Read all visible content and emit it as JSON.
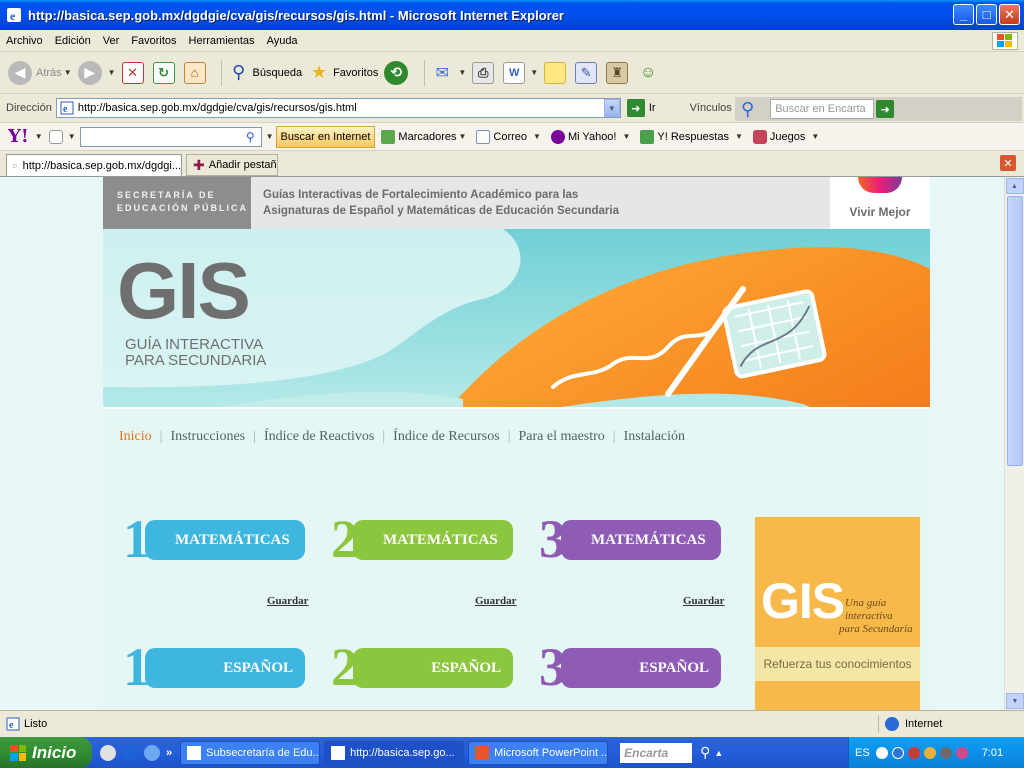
{
  "window": {
    "title": "http://basica.sep.gob.mx/dgdgie/cva/gis/recursos/gis.html - Microsoft Internet Explorer"
  },
  "menu": [
    "Archivo",
    "Edición",
    "Ver",
    "Favoritos",
    "Herramientas",
    "Ayuda"
  ],
  "toolbar": {
    "back": "Atrás",
    "search": "Búsqueda",
    "favorites": "Favoritos"
  },
  "address": {
    "label": "Dirección",
    "url": "http://basica.sep.gob.mx/dgdgie/cva/gis/recursos/gis.html",
    "go": "Ir",
    "links": "Vínculos",
    "encarta_placeholder": "Buscar en Encarta"
  },
  "yahoo": {
    "logo": "Y!",
    "search_button": "Buscar en Internet",
    "bookmarks": "Marcadores",
    "mail": "Correo",
    "myyahoo": "Mi Yahoo!",
    "answers": "Y! Respuestas",
    "games": "Juegos"
  },
  "tabs": {
    "current": "http://basica.sep.gob.mx/dgdgi...",
    "add": "Añadir pestaña"
  },
  "site": {
    "sep_line1": "SECRETARÍA DE",
    "sep_line2": "EDUCACIÓN PÚBLICA",
    "header_line1": "Guías Interactivas de Fortalecimiento Académico para las",
    "header_line2": "Asignaturas de Español y Matemáticas de Educación Secundaria",
    "vivir": "Vivir Mejor",
    "gis": "GIS",
    "gis_sub1": "GUÍA INTERACTIVA",
    "gis_sub2": "PARA SECUNDARIA",
    "nav": [
      "Inicio",
      "Instrucciones",
      "Índice de Reactivos",
      "Índice de Recursos",
      "Para el maestro",
      "Instalación"
    ],
    "cards": [
      {
        "num": "1",
        "label": "MATEMÁTICAS",
        "color": "#3fb6e0"
      },
      {
        "num": "2",
        "label": "MATEMÁTICAS",
        "color": "#8cc63f"
      },
      {
        "num": "3",
        "label": "MATEMÁTICAS",
        "color": "#8e5bb5"
      },
      {
        "num": "1",
        "label": "ESPAÑOL",
        "color": "#3fb6e0"
      },
      {
        "num": "2",
        "label": "ESPAÑOL",
        "color": "#8cc63f"
      },
      {
        "num": "3",
        "label": "ESPAÑOL",
        "color": "#8e5bb5"
      }
    ],
    "save": "Guardar",
    "promo": {
      "gis": "GIS",
      "tag1": "Una guía",
      "tag2": "interactiva",
      "tag3": "para Secundaria",
      "refuerza": "Refuerza tus conocimientos"
    }
  },
  "status": {
    "text": "Listo",
    "zone": "Internet"
  },
  "taskbar": {
    "start": "Inicio",
    "tasks": [
      "Subsecretaría de Edu...",
      "http://basica.sep.go...",
      "Microsoft PowerPoint ..."
    ],
    "encarta": "Encarta",
    "lang": "ES",
    "clock": "7:01"
  }
}
